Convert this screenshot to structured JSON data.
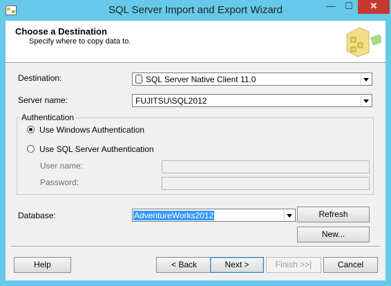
{
  "window": {
    "title": "SQL Server Import and Export Wizard",
    "minimize_glyph": "—",
    "maximize_glyph": "☐",
    "close_glyph": "✕"
  },
  "header": {
    "title": "Choose a Destination",
    "subtitle": "Specify where to copy data to."
  },
  "form": {
    "destination_label": "Destination:",
    "destination_value": "SQL Server Native Client 11.0",
    "server_name_label": "Server name:",
    "server_name_value": "FUJITSU\\SQL2012",
    "auth_group_label": "Authentication",
    "auth_windows_label": "Use Windows Authentication",
    "auth_sql_label": "Use SQL Server Authentication",
    "auth_selected": "windows",
    "user_name_label": "User name:",
    "user_name_value": "",
    "password_label": "Password:",
    "password_value": "",
    "database_label": "Database:",
    "database_value": "AdventureWorks2012",
    "refresh_label": "Refresh",
    "new_label": "New..."
  },
  "footer": {
    "help_label": "Help",
    "back_label": "< Back",
    "next_label": "Next >",
    "finish_label": "Finish >>|",
    "cancel_label": "Cancel"
  },
  "colors": {
    "titlebar": "#66c9e9",
    "close_button": "#c7392e",
    "selection": "#3399ff"
  }
}
